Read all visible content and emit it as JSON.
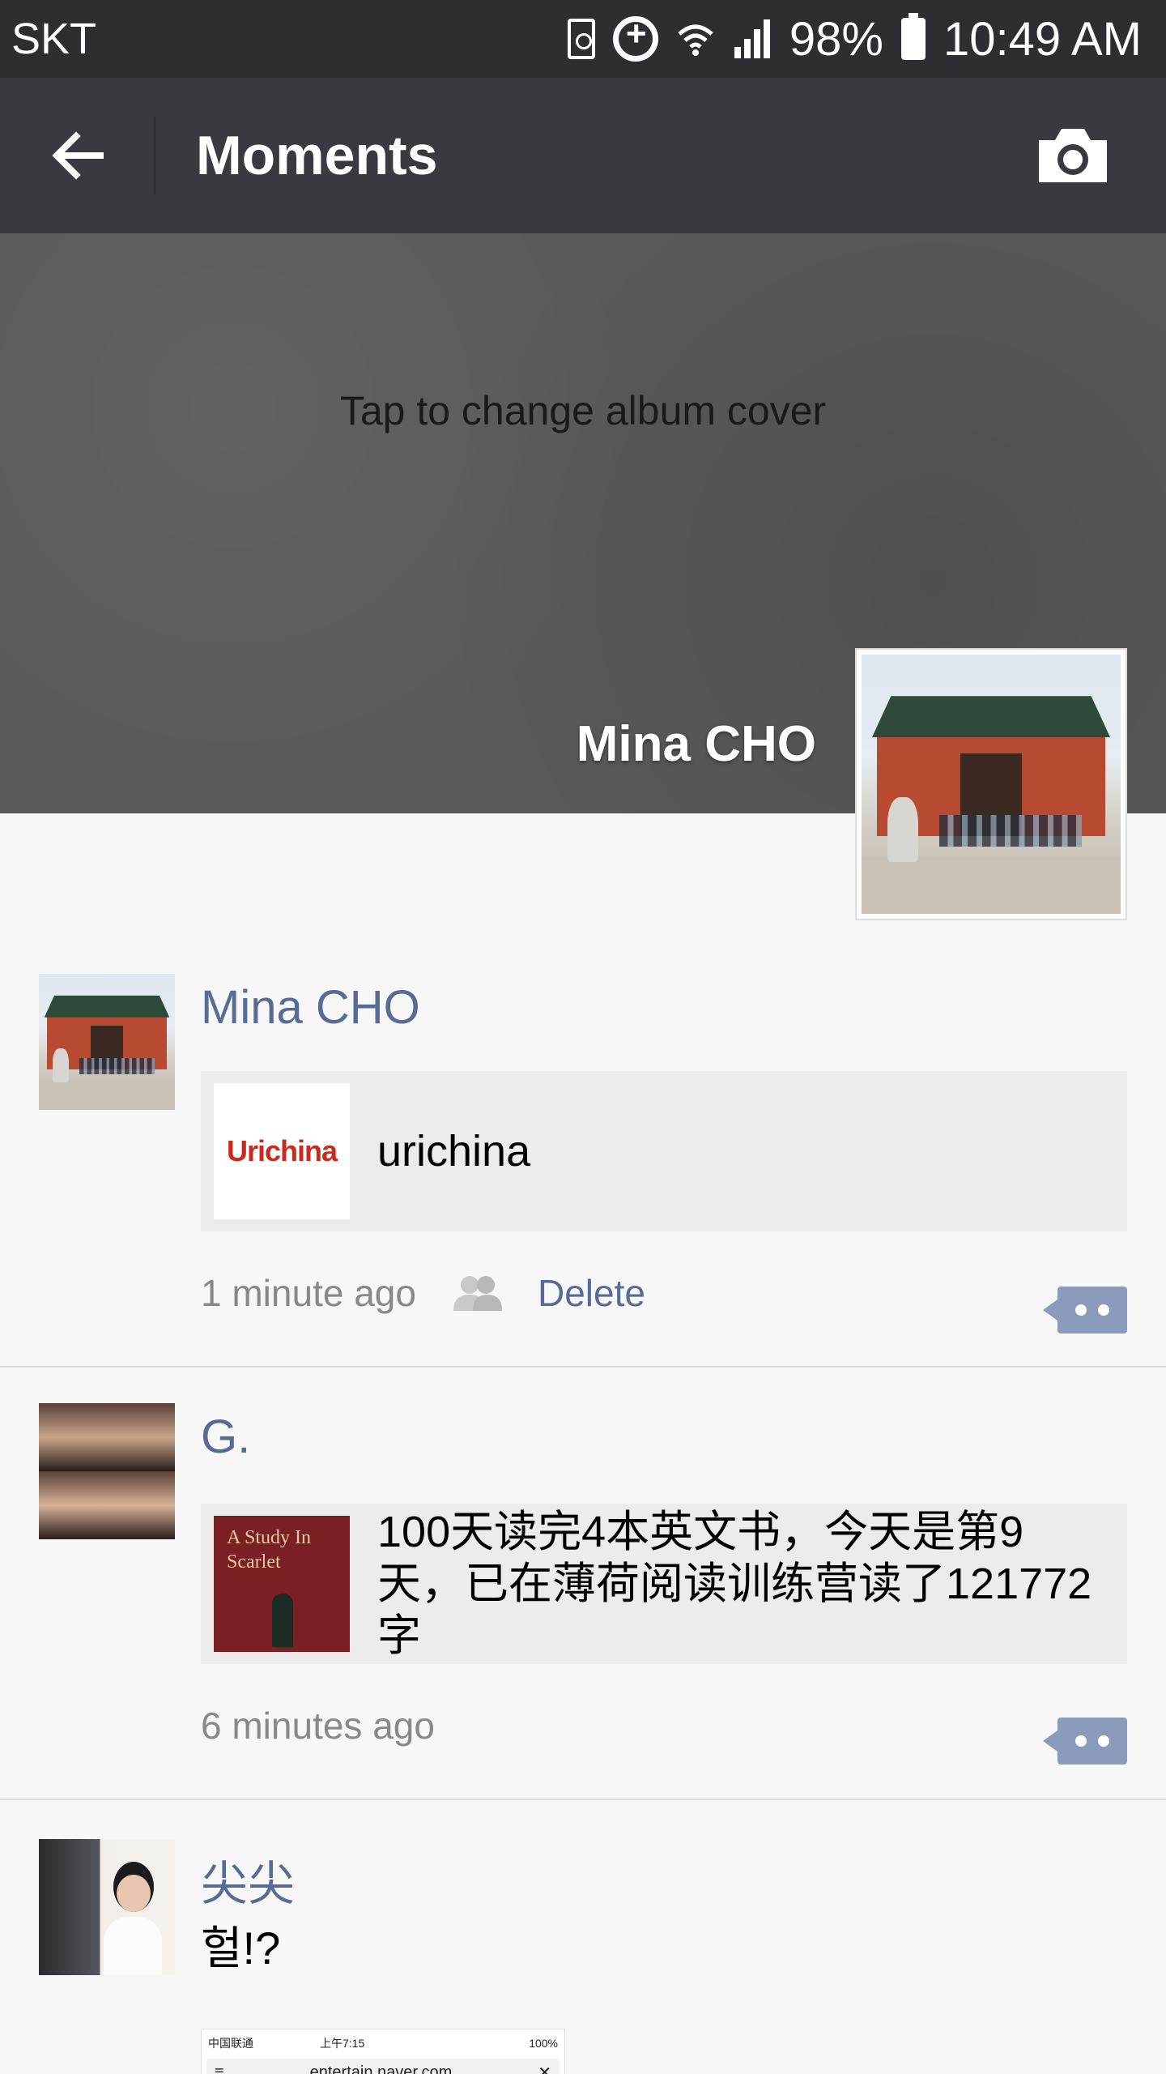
{
  "status_bar": {
    "carrier": "SKT",
    "battery_percent": "98%",
    "time": "10:49 AM",
    "icons": [
      "battery-saver-icon",
      "sync-icon",
      "wifi-icon",
      "signal-icon",
      "battery-icon"
    ]
  },
  "app_bar": {
    "title": "Moments",
    "back_icon": "arrow-left-icon",
    "camera_icon": "camera-icon"
  },
  "cover": {
    "hint": "Tap to change album cover",
    "profile_name": "Mina CHO"
  },
  "posts": [
    {
      "name": "Mina CHO",
      "link_title": "urichina",
      "link_thumb_text": "Urichina",
      "time": "1 minute ago",
      "delete_label": "Delete"
    },
    {
      "name": "G.",
      "link_title": "100天读完4本英文书，今天是第9天，已在薄荷阅读训练营读了121772字",
      "book_title": "A Study In Scarlet",
      "time": "6 minutes ago"
    },
    {
      "name": "尖尖",
      "text": "헐!?",
      "screenshot_status": "中国联通",
      "screenshot_time": "上午7:15",
      "screenshot_battery": "100%",
      "screenshot_url": "entertain.naver.com"
    }
  ],
  "colors": {
    "status_bar": "#2d2e31",
    "app_bar": "#393a3f",
    "name_link": "#576b95",
    "comment_button": "#8a9aba"
  }
}
